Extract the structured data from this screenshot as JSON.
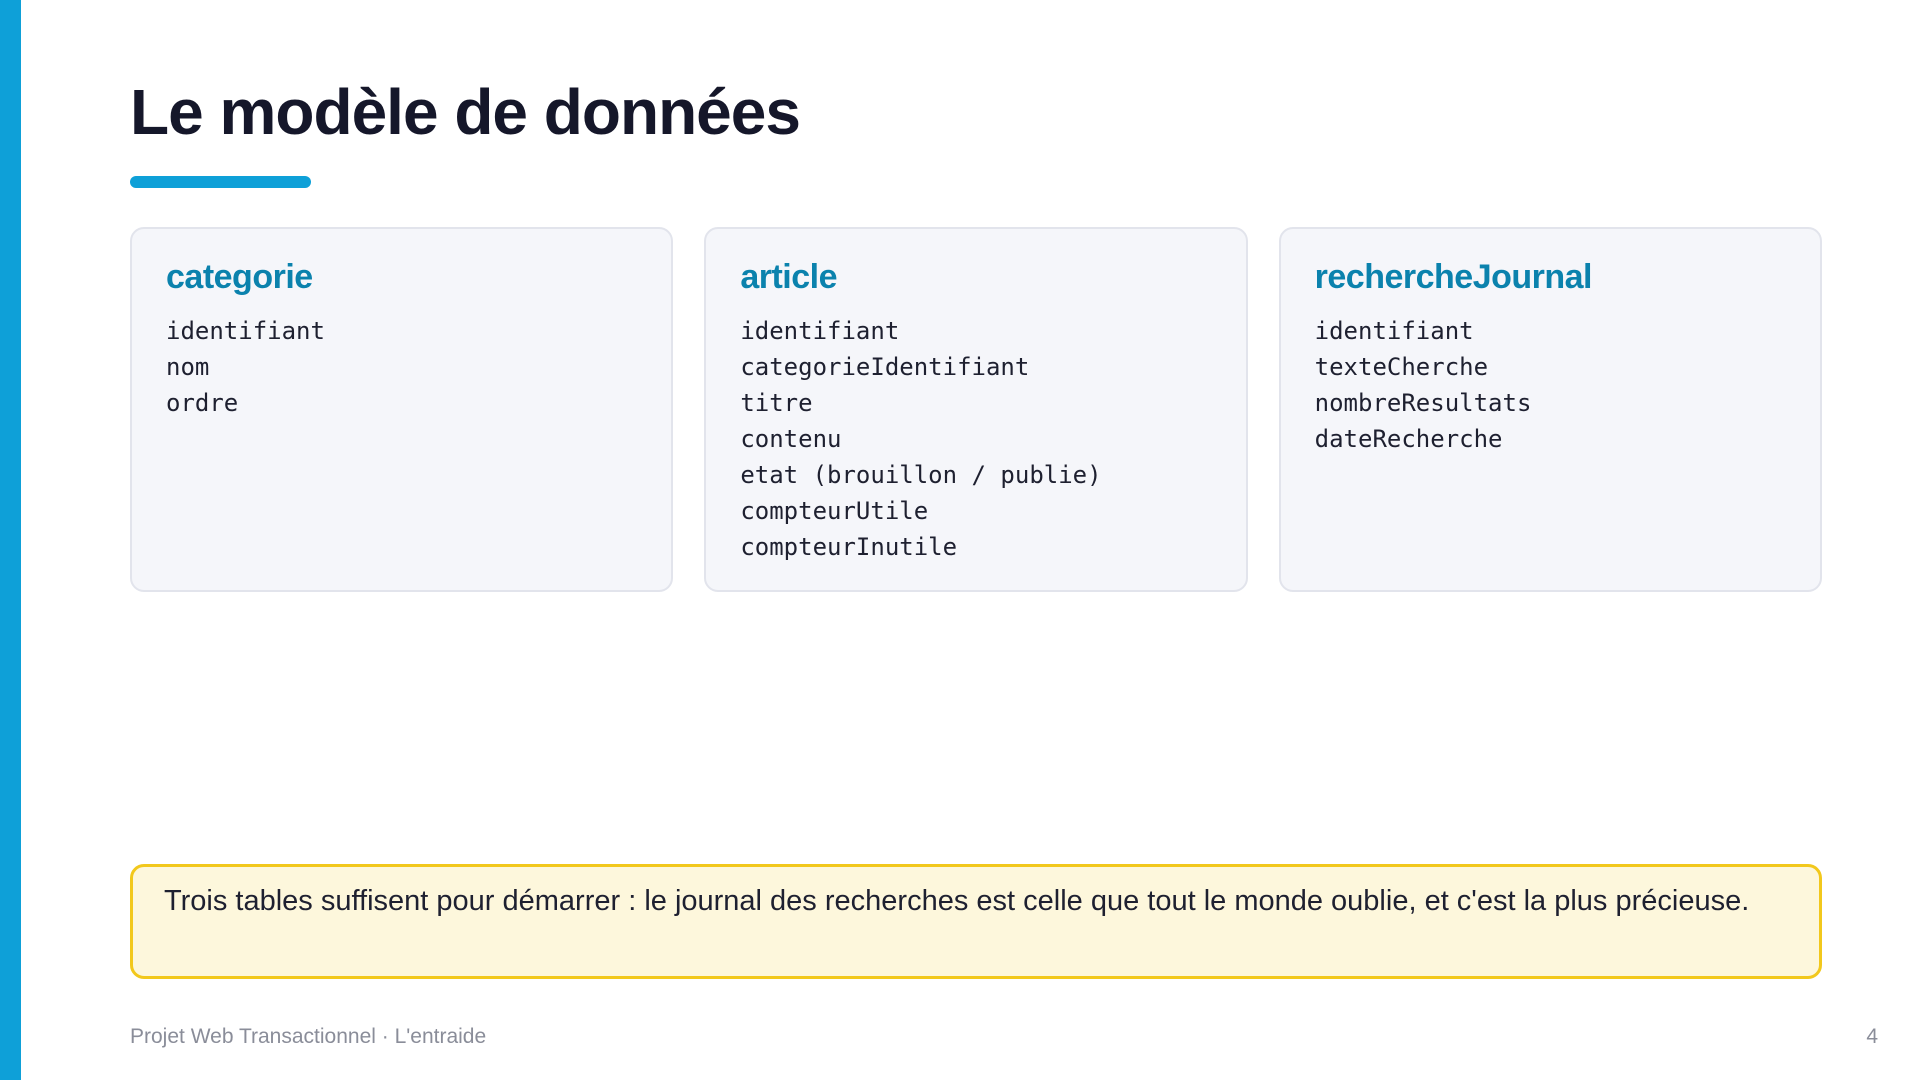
{
  "slide": {
    "title": "Le modèle de données",
    "accent_color": "#0ea0d8",
    "page_number": "4"
  },
  "tables": [
    {
      "name": "categorie",
      "fields": [
        "identifiant",
        "nom",
        "ordre"
      ]
    },
    {
      "name": "article",
      "fields": [
        "identifiant",
        "categorieIdentifiant",
        "titre",
        "contenu",
        "etat (brouillon / publie)",
        "compteurUtile",
        "compteurInutile"
      ]
    },
    {
      "name": "rechercheJournal",
      "fields": [
        "identifiant",
        "texteCherche",
        "nombreResultats",
        "dateRecherche"
      ]
    }
  ],
  "callout": {
    "text": "Trois tables suffisent pour démarrer : le journal des recherches est celle que tout le monde oublie, et c'est la plus précieuse."
  },
  "footer": {
    "text": "Projet Web Transactionnel · L'entraide"
  }
}
